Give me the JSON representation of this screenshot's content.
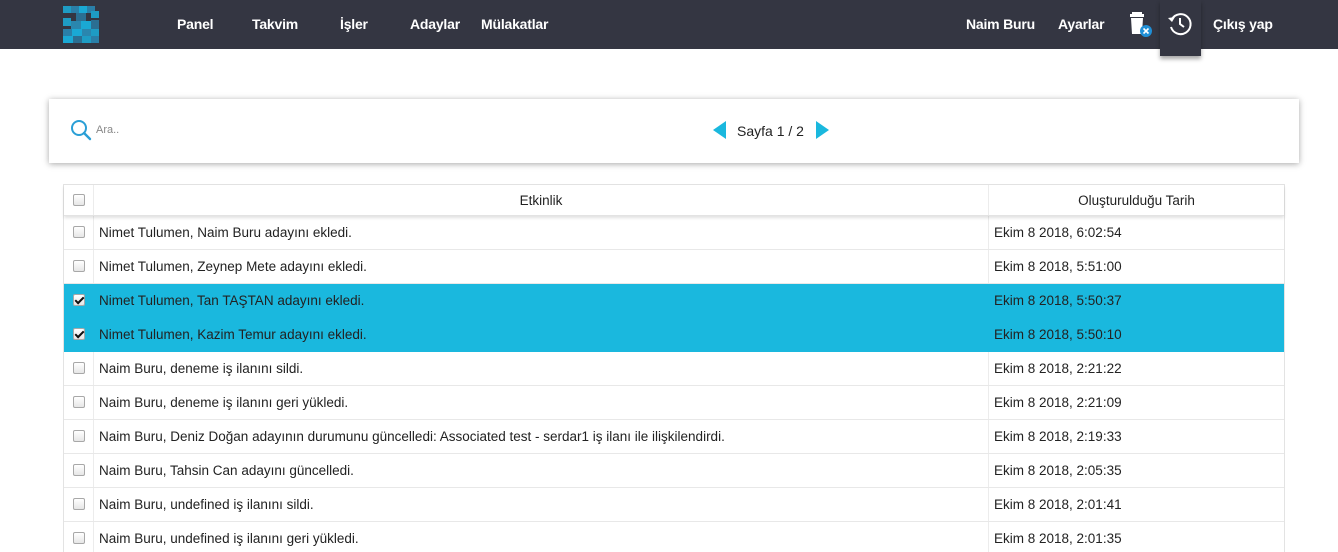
{
  "nav": {
    "logo_icon": "brand-logo",
    "items": [
      "Panel",
      "Takvim",
      "İşler",
      "Adaylar",
      "Mülakatlar"
    ],
    "user_name": "Naim Buru",
    "settings": "Ayarlar",
    "trash_icon": "recycle-bin-icon",
    "history_icon": "history-clock-icon",
    "logout": "Çıkış yap",
    "bg_color": "#343642"
  },
  "search": {
    "placeholder": "Ara..",
    "value": ""
  },
  "pagination": {
    "label": "Sayfa 1 / 2",
    "accent_color": "#1ab8de"
  },
  "table": {
    "headers": {
      "activity": "Etkinlik",
      "created": "Oluşturulduğu Tarih"
    },
    "select_all_checked": false,
    "selected_color": "#1ab8de",
    "rows": [
      {
        "checked": false,
        "activity": "Nimet Tulumen, Naim Buru adayını ekledi.",
        "date": "Ekim 8 2018, 6:02:54"
      },
      {
        "checked": false,
        "activity": "Nimet Tulumen, Zeynep Mete adayını ekledi.",
        "date": "Ekim 8 2018, 5:51:00"
      },
      {
        "checked": true,
        "activity": "Nimet Tulumen, Tan TAŞTAN adayını ekledi.",
        "date": "Ekim 8 2018, 5:50:37"
      },
      {
        "checked": true,
        "activity": "Nimet Tulumen, Kazim Temur adayını ekledi.",
        "date": "Ekim 8 2018, 5:50:10"
      },
      {
        "checked": false,
        "activity": "Naim Buru, deneme iş ilanını sildi.",
        "date": "Ekim 8 2018, 2:21:22"
      },
      {
        "checked": false,
        "activity": "Naim Buru, deneme iş ilanını geri yükledi.",
        "date": "Ekim 8 2018, 2:21:09"
      },
      {
        "checked": false,
        "activity": "Naim Buru, Deniz Doğan adayının durumunu güncelledi: Associated test - serdar1 iş ilanı ile ilişkilendirdi.",
        "date": "Ekim 8 2018, 2:19:33"
      },
      {
        "checked": false,
        "activity": "Naim Buru, Tahsin Can adayını güncelledi.",
        "date": "Ekim 8 2018, 2:05:35"
      },
      {
        "checked": false,
        "activity": "Naim Buru, undefined iş ilanını sildi.",
        "date": "Ekim 8 2018, 2:01:41"
      },
      {
        "checked": false,
        "activity": "Naim Buru, undefined iş ilanını geri yükledi.",
        "date": "Ekim 8 2018, 2:01:35"
      }
    ]
  }
}
